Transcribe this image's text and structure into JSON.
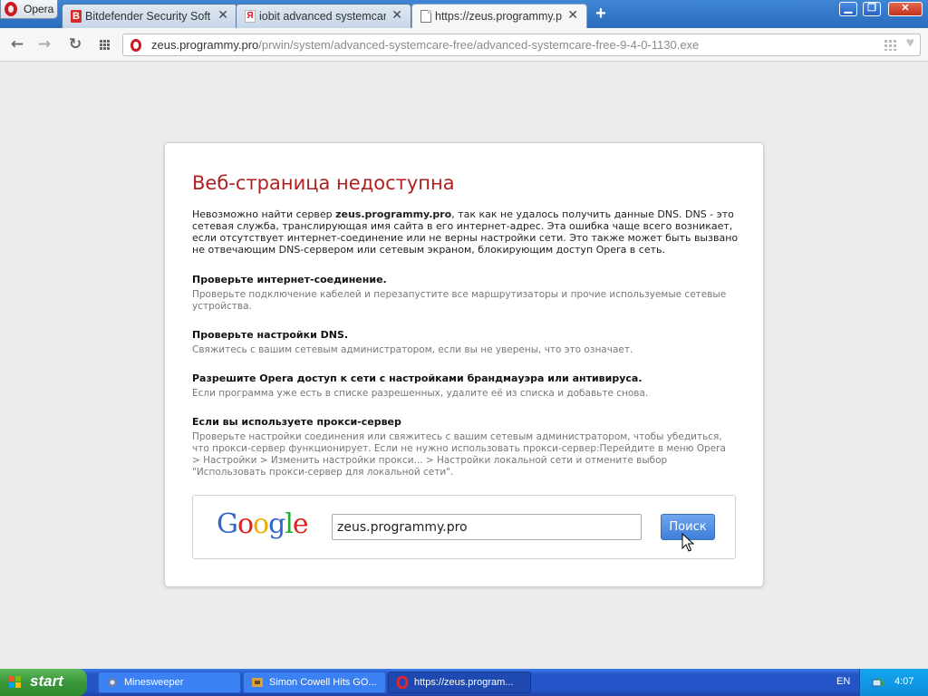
{
  "browser": {
    "menu_label": "Opera",
    "tabs": [
      {
        "label": "Bitdefender Security Soft",
        "icon": "bitdefender-b-icon",
        "icon_text": "B",
        "active": false
      },
      {
        "label": "iobit advanced systemcare",
        "icon": "yandex-icon",
        "icon_text": "Я",
        "active": false
      },
      {
        "label": "https://zeus.programmy.pro/",
        "icon": "page-icon",
        "active": true
      }
    ],
    "tab_close_glyph": "✕",
    "new_tab_glyph": "+",
    "window_buttons": {
      "minimize": "▁",
      "maximize": "❐",
      "close": "✕"
    },
    "toolbar": {
      "back": "←",
      "forward": "→",
      "reload": "↻"
    },
    "url": {
      "host_prefix": "zeus.",
      "host": "programmy.pro",
      "path": "/prwin/system/advanced-systemcare-free/advanced-systemcare-free-9-4-0-1130.exe"
    }
  },
  "error_page": {
    "title": "Веб-страница недоступна",
    "desc_before": "Невозможно найти сервер ",
    "desc_server": "zeus.programmy.pro",
    "desc_after": ", так как не удалось получить данные DNS. DNS - это сетевая служба, транслирующая имя сайта в его интернет-адрес. Эта ошибка чаще всего возникает, если отсутствует интернет-соединение или не верны настройки сети. Это также может быть вызвано не отвечающим DNS-сервером или сетевым экраном, блокирующим доступ Opera в сеть.",
    "sections": [
      {
        "title": "Проверьте интернет-соединение.",
        "body": "Проверьте подключение кабелей и перезапустите все маршрутизаторы и прочие используемые сетевые устройства."
      },
      {
        "title": "Проверьте настройки DNS.",
        "body": "Свяжитесь с вашим сетевым администратором, если вы не уверены, что это означает."
      },
      {
        "title": "Разрешите Opera доступ к сети с настройками брандмауэра или антивируса.",
        "body": "Если программа уже есть в списке разрешенных, удалите её из списка и добавьте снова."
      },
      {
        "title": "Если вы используете прокси-сервер",
        "body": "Проверьте настройки соединения или свяжитесь с вашим сетевым администратором, чтобы убедиться, что прокси-сервер функционирует. Если не нужно использовать прокси-сервер:Перейдите в меню Opera > Настройки > Изменить настройки прокси... > Настройки локальной сети и отмените выбор \"Использовать прокси-сервер для локальной сети\"."
      }
    ],
    "search": {
      "logo_letters": [
        "G",
        "o",
        "o",
        "g",
        "l",
        "e"
      ],
      "logo_colors": [
        "#3366cc",
        "#dd2222",
        "#e8b000",
        "#3366cc",
        "#22aa33",
        "#dd2222"
      ],
      "input_value": "zeus.programmy.pro",
      "button_label": "Поиск"
    }
  },
  "taskbar": {
    "start_label": "start",
    "tasks": [
      {
        "label": "Minesweeper",
        "icon": "minesweeper-icon",
        "active": false
      },
      {
        "label": "Simon Cowell Hits GO...",
        "icon": "media-icon",
        "active": false
      },
      {
        "label": "https://zeus.program...",
        "icon": "opera-icon",
        "active": true
      }
    ],
    "language": "EN",
    "clock": "4:07"
  },
  "colors": {
    "error_title": "#b02020",
    "opera_red": "#cc1b22",
    "xp_blue": "#2554c7",
    "start_green": "#3a963a"
  }
}
